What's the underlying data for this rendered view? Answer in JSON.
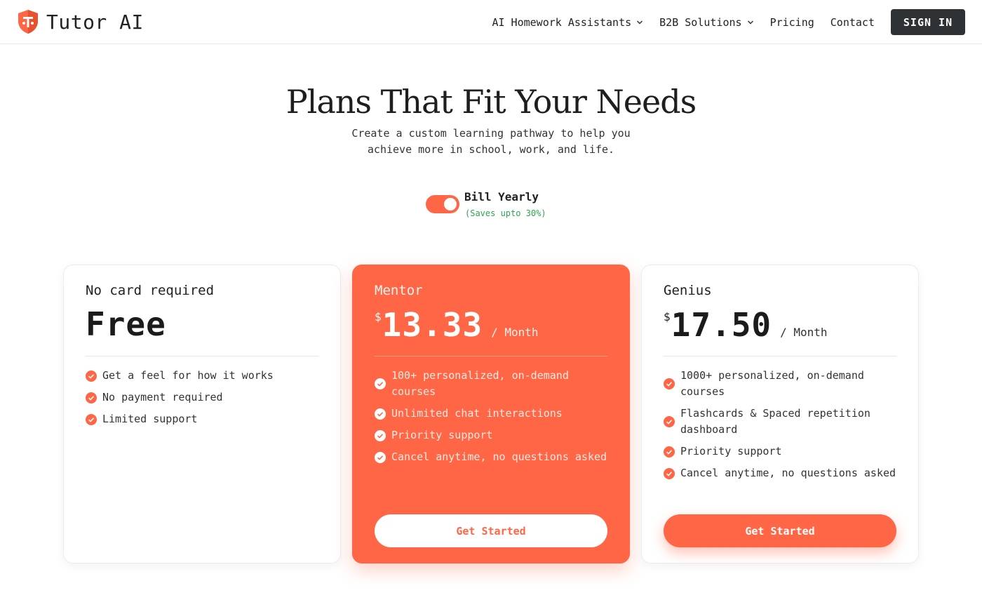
{
  "brand": {
    "name": "Tutor AI",
    "logo_icon": "shield-logo-icon",
    "accent": "#ff6645"
  },
  "nav": {
    "items": [
      {
        "label": "AI Homework Assistants",
        "dropdown": true
      },
      {
        "label": "B2B Solutions",
        "dropdown": true
      },
      {
        "label": "Pricing",
        "dropdown": false
      },
      {
        "label": "Contact",
        "dropdown": false
      }
    ],
    "signin_label": "SIGN IN"
  },
  "hero": {
    "title": "Plans That Fit Your Needs",
    "subtitle_line1": "Create a custom learning pathway to help you",
    "subtitle_line2": "achieve more in school, work, and life."
  },
  "billing": {
    "toggle_on": true,
    "label": "Bill Yearly",
    "note": "(Saves upto 30%)",
    "note_color": "#2ea34f"
  },
  "plans": [
    {
      "name": "No card required",
      "price": "Free",
      "features": [
        "Get a feel for how it works",
        "No payment required",
        "Limited support"
      ]
    },
    {
      "name": "Mentor",
      "currency": "$",
      "amount": "13.33",
      "per": "/ Month",
      "features": [
        "100+ personalized, on-demand courses",
        "Unlimited chat interactions",
        "Priority support",
        "Cancel anytime, no questions asked"
      ],
      "cta": "Get Started"
    },
    {
      "name": "Genius",
      "currency": "$",
      "amount": "17.50",
      "per": "/ Month",
      "features": [
        "1000+ personalized, on-demand courses",
        "Flashcards & Spaced repetition dashboard",
        "Priority support",
        "Cancel anytime, no questions asked"
      ],
      "cta": "Get Started"
    }
  ]
}
